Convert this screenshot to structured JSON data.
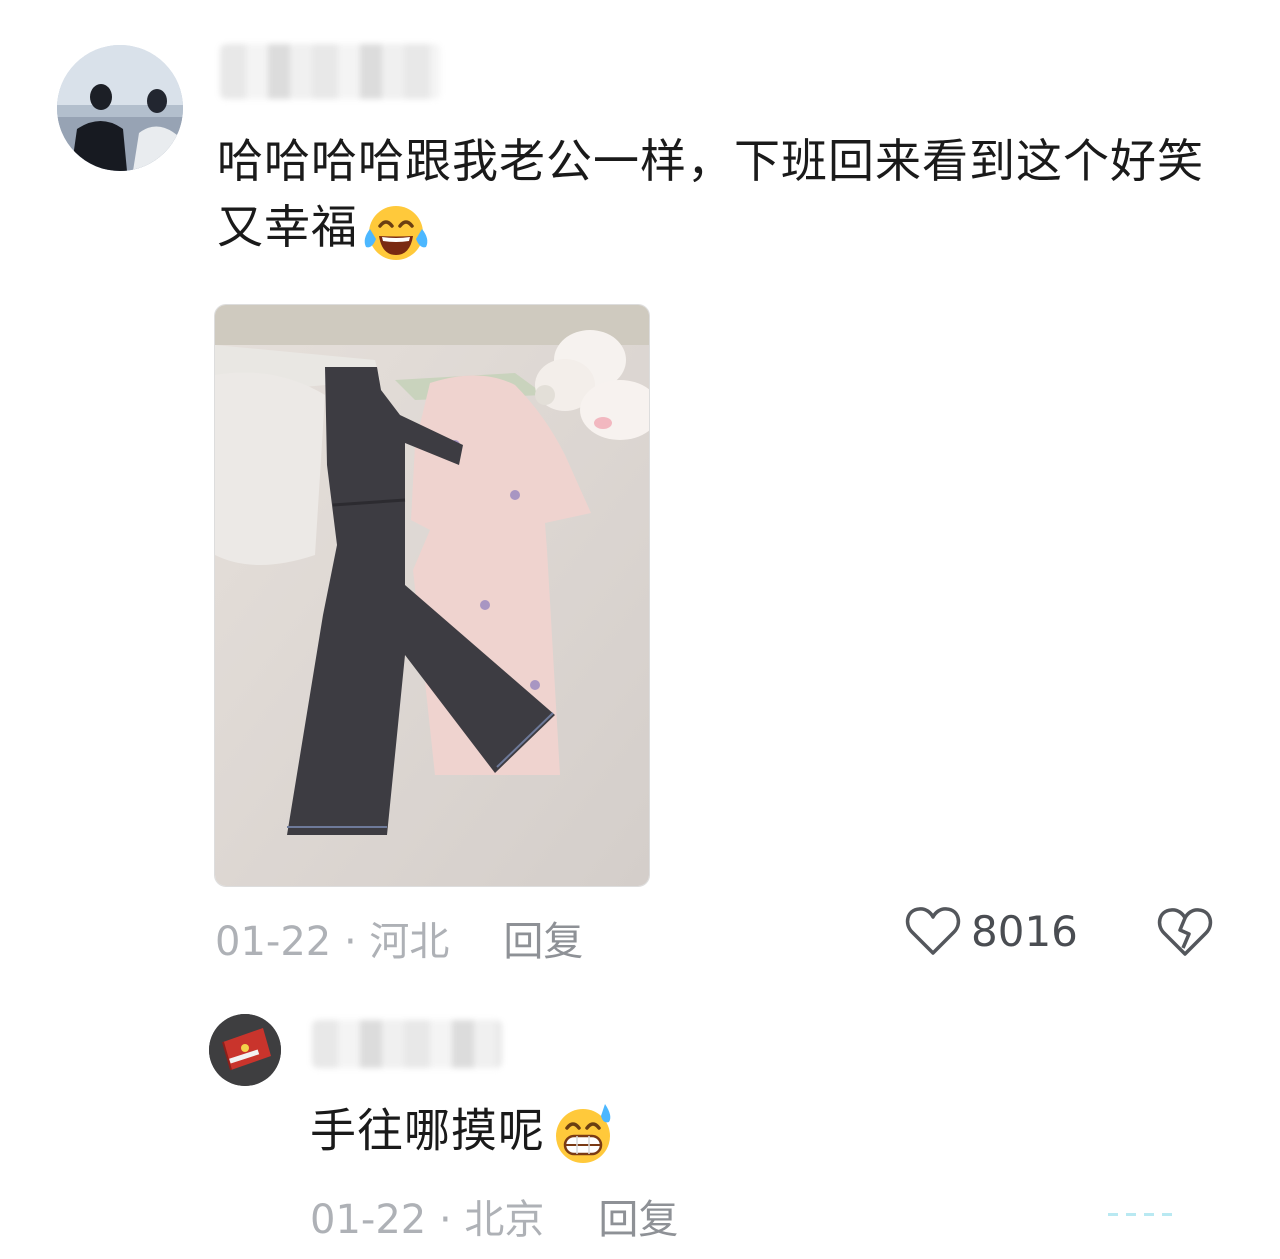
{
  "comment": {
    "text": "哈哈哈哈跟我老公一样，下班回来看到这个好笑又幸福",
    "emoji": "tears-of-joy-emoji",
    "date": "01-22",
    "location": "河北",
    "reply_label": "回复",
    "likes": "8016"
  },
  "reply": {
    "text": "手往哪摸呢",
    "emoji": "grinning-sweat-emoji",
    "date": "01-22",
    "location": "北京",
    "reply_label": "回复"
  },
  "separator": " · "
}
